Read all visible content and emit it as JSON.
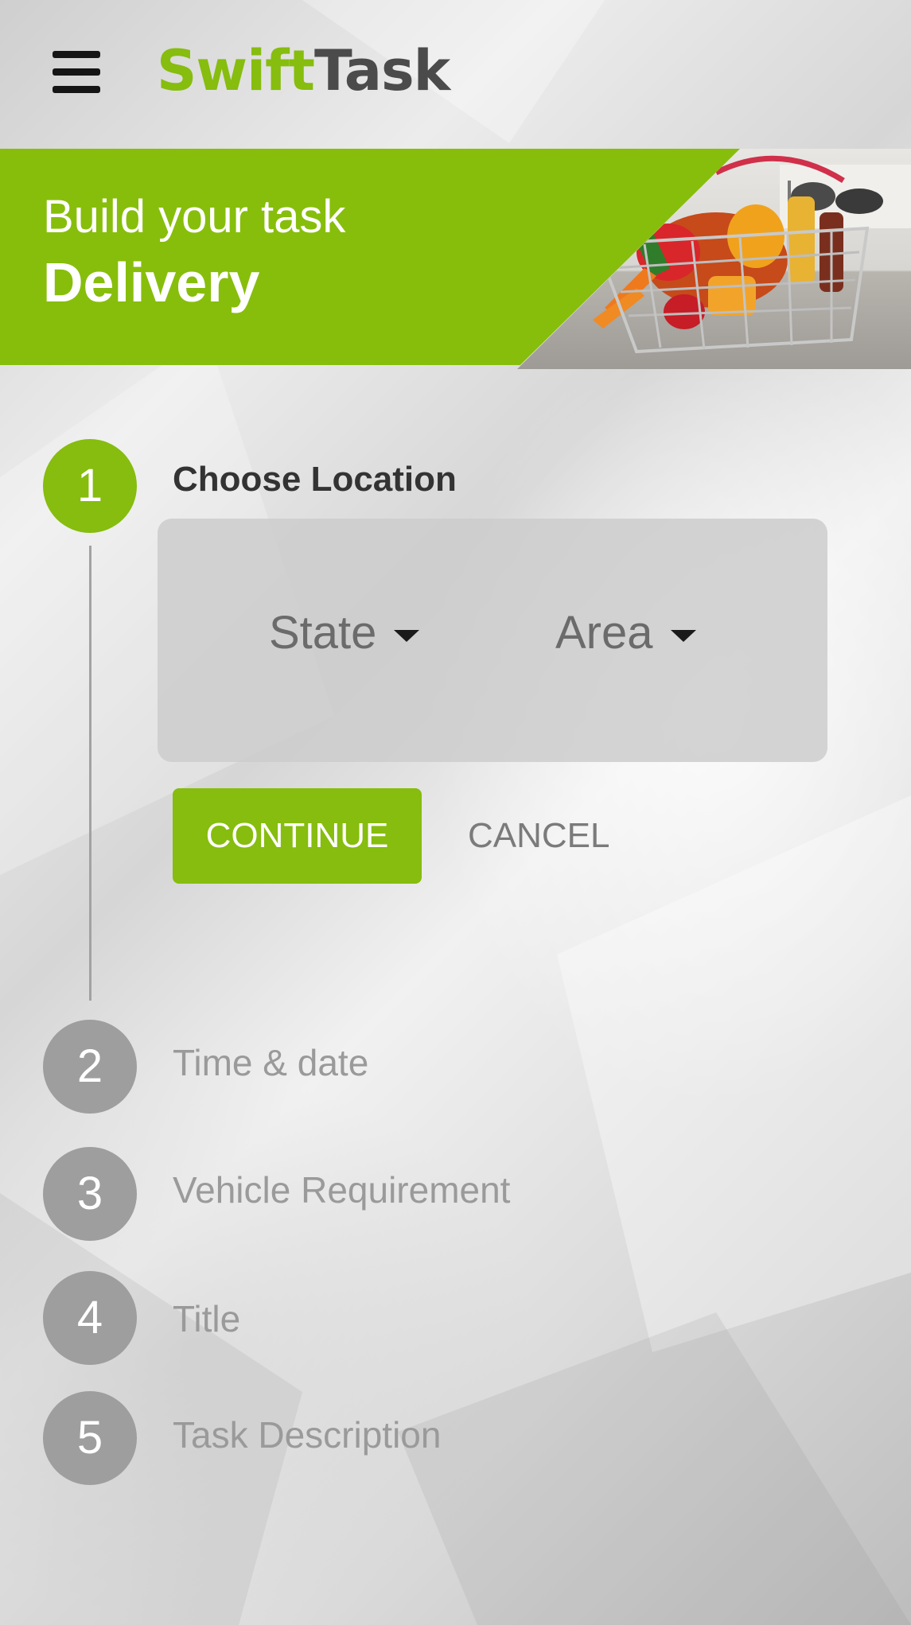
{
  "app": {
    "logo_part1": "Swift",
    "logo_part2": "Task",
    "menu_icon": "hamburger-menu-icon"
  },
  "banner": {
    "subtitle": "Build your task",
    "title": "Delivery",
    "image": "grocery-basket-photo"
  },
  "stepper": {
    "steps": [
      {
        "number": "1",
        "label": "Choose Location",
        "state": "active"
      },
      {
        "number": "2",
        "label": "Time & date",
        "state": "inactive"
      },
      {
        "number": "3",
        "label": "Vehicle Requirement",
        "state": "inactive"
      },
      {
        "number": "4",
        "label": "Title",
        "state": "inactive"
      },
      {
        "number": "5",
        "label": "Task Description",
        "state": "inactive"
      }
    ],
    "location": {
      "state_dropdown": "State",
      "area_dropdown": "Area"
    },
    "continue_label": "CONTINUE",
    "cancel_label": "CANCEL"
  },
  "colors": {
    "accent": "#86bd0e",
    "inactive": "#9e9e9e",
    "logo_dark": "#4b4b4b"
  }
}
